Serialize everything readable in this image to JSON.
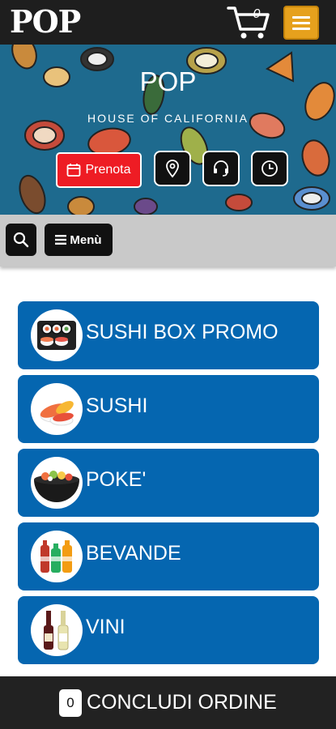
{
  "header": {
    "logo": "POP",
    "cart_count": "0",
    "cart_icon": "cart-icon",
    "menu_icon": "hamburger-icon",
    "colors": {
      "bar": "#1e1e1e",
      "menu_button": "#e6a11d"
    }
  },
  "hero": {
    "title": "POP",
    "subtitle": "HOUSE OF CALIFORNIA",
    "prenota_label": "Prenota",
    "icons": [
      "calendar-icon",
      "location-pin-icon",
      "headset-icon",
      "clock-icon"
    ],
    "colors": {
      "background": "#1e6a8e",
      "prenota": "#ee1c24"
    }
  },
  "toolbar": {
    "search_icon": "search-icon",
    "menu_label": "Menù"
  },
  "categories": [
    {
      "label": "SUSHI BOX PROMO",
      "icon": "sushi-box-icon"
    },
    {
      "label": "SUSHI",
      "icon": "nigiri-icon"
    },
    {
      "label": "POKE'",
      "icon": "poke-bowl-icon"
    },
    {
      "label": "BEVANDE",
      "icon": "drinks-icon"
    },
    {
      "label": "VINI",
      "icon": "wine-bottles-icon"
    }
  ],
  "category_color": "#0566b0",
  "footer": {
    "count": "0",
    "label": "CONCLUDI ORDINE"
  }
}
